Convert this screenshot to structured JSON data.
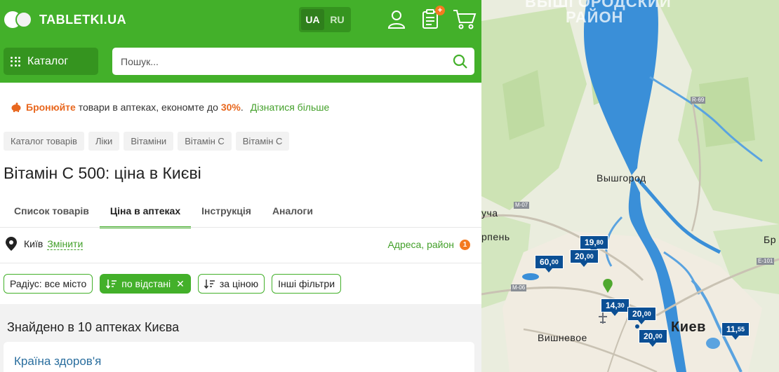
{
  "header": {
    "logo_text": "TABLETKI.UA",
    "lang": [
      "UA",
      "RU"
    ],
    "active_lang": "UA",
    "orders_badge": "+",
    "catalog_label": "Каталог",
    "search_placeholder": "Пошук..."
  },
  "promo": {
    "strong": "Бронюйте",
    "text": " товари в аптеках, економте до ",
    "percent": "30%",
    "after": ".",
    "link": "Дізнатися більше"
  },
  "breadcrumbs": [
    "Каталог товарів",
    "Ліки",
    "Вітаміни",
    "Вітамін С",
    "Вітамін С"
  ],
  "page_title": "Вітамін С 500: ціна в Києві",
  "tabs": [
    "Список товарів",
    "Ціна в аптеках",
    "Інструкція",
    "Аналоги"
  ],
  "active_tab": 1,
  "location": {
    "city": "Київ",
    "change": "Змінити",
    "address_link": "Адреса, район",
    "address_badge": "1"
  },
  "filters": {
    "radius": "Радіус: все місто",
    "by_distance": "по відстані",
    "by_price": "за ціною",
    "other": "Інші фільтри"
  },
  "results": {
    "found": "Знайдено в 10 аптеках Києва",
    "first_pharmacy": "Країна здоров'я"
  },
  "map": {
    "region_label_1": "ВЫШГОРОДСКИЙ",
    "region_label_2": "РАЙОН",
    "places": {
      "vyshgorod": "Вышгород",
      "kiev": "Киев",
      "vishnevoe": "Вишневое",
      "bucha": "уча",
      "irpen": "рпень",
      "br": "Бр"
    },
    "roads": [
      "R-69",
      "M-07",
      "M-06",
      "E-101"
    ],
    "prices": [
      {
        "main": "19",
        "cents": "80"
      },
      {
        "main": "20",
        "cents": "00"
      },
      {
        "main": "60",
        "cents": "00"
      },
      {
        "main": "14",
        "cents": "30"
      },
      {
        "main": "20",
        "cents": "00"
      },
      {
        "main": "20",
        "cents": "00"
      },
      {
        "main": "11",
        "cents": "55"
      }
    ]
  },
  "colors": {
    "brand": "#43b02a",
    "accent": "#f47a20",
    "price_marker": "#0b4f94"
  }
}
